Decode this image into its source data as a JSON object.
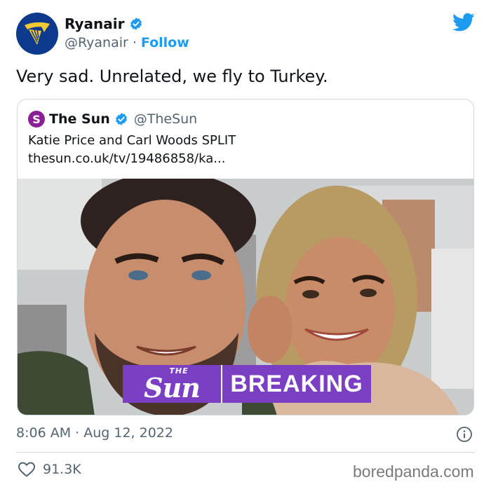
{
  "tweet": {
    "author": {
      "display_name": "Ryanair",
      "handle": "@Ryanair",
      "separator": "·",
      "follow_label": "Follow",
      "avatar_icon": "ryanair-harp-logo",
      "verified_icon": "verified-badge-icon"
    },
    "platform_icon": "twitter-bird-icon",
    "text": "Very sad. Unrelated, we fly to Turkey.",
    "timestamp": "8:06 AM · Aug 12, 2022",
    "likes": "91.3K",
    "like_icon": "heart-icon",
    "info_icon": "info-icon"
  },
  "quote": {
    "logo_letter": "S",
    "display_name": "The Sun",
    "handle": "@TheSun",
    "title": "Katie Price and Carl Woods SPLIT",
    "link": "thesun.co.uk/tv/19486858/ka...",
    "image": {
      "description_icon": "couple-selfie-photo",
      "banner_the": "THE",
      "banner_sun": "Sun",
      "banner_breaking": "BREAKING"
    }
  },
  "watermark": "boredpanda.com",
  "colors": {
    "twitter_blue": "#1d9bf0",
    "ryanair_navy": "#0d3a8c",
    "ryanair_gold": "#f1c933",
    "sun_purple": "#7b3fc4",
    "text_secondary": "#536471",
    "border": "#cfd9de"
  }
}
